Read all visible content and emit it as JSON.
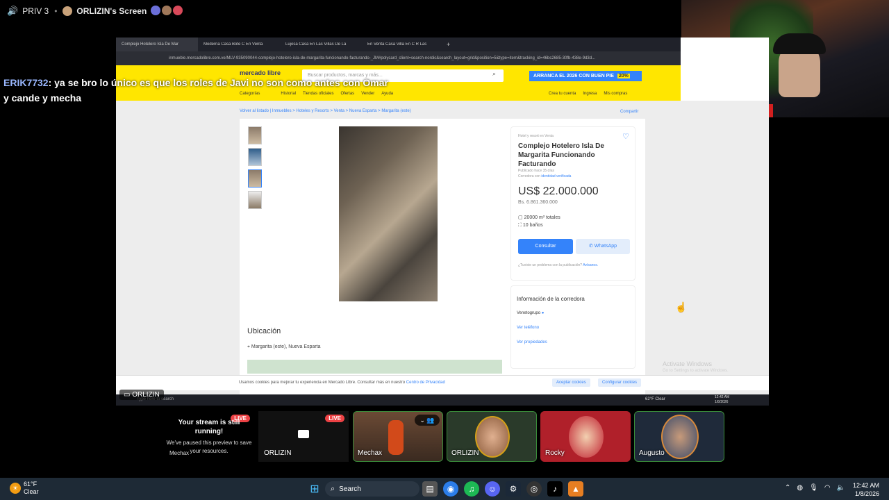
{
  "discord": {
    "channel": "PRIV 3",
    "screen_title": "ORLIZIN's Screen",
    "chat": {
      "user": "ERIK7732",
      "message": ": ya se bro lo único es que los roles de Javi no son como antes con Omar y cande y mecha"
    },
    "stream_label": "ORLIZIN",
    "paused_title": "Your stream is still running!",
    "paused_body": "We've paused this preview to save your resources.",
    "live": "LIVE",
    "participants": [
      {
        "name": "Mechax"
      },
      {
        "name": "ORLIZIN"
      },
      {
        "name": "Mechax"
      },
      {
        "name": "ORLIZIN"
      },
      {
        "name": "Rocky"
      },
      {
        "name": "Augusto"
      }
    ]
  },
  "browser": {
    "tabs": [
      "Complejo Hotelero Isla De Mar",
      "Moderna Casa Bote C En Venta",
      "Lujosa Casa En Las Villas De La",
      "En Venta Casa Villa En C R Las"
    ],
    "url": "inmueble.mercadolibre.com.ve/MLV-935090044-complejo-hotelero-isla-de-margarita-funcionando-facturando-_JM#polycard_client=search-nordic&search_layout=grid&position=5&type=item&tracking_id=46bc2685-30fb-438e-9d3d..."
  },
  "ml": {
    "logo": "mercado libre",
    "search_placeholder": "Buscar productos, marcas y más...",
    "promo": "ARRANCA EL 2026 CON BUEN PIE",
    "promo_badge": "20%",
    "nav": [
      "Categorías",
      "Historial",
      "Tiendas oficiales",
      "Ofertas",
      "Vender",
      "Ayuda"
    ],
    "nav_right": [
      "Crea tu cuenta",
      "Ingresa",
      "Mis compras"
    ],
    "breadcrumb": "Volver al listado  |  Inmuebles > Hoteles y Resorts > Venta > Nueva Esparta > Margarita (este)",
    "share": "Compartir",
    "category": "Hotel y resort en Venta",
    "title": "Complejo Hotelero Isla De Margarita Funcionando Facturando",
    "published": "Publicado hace 35 días",
    "broker_prefix": "Corredora con",
    "broker_verified": "identidad verificada",
    "price": "US$ 22.000.000",
    "price_local": "Bs. 6.861.360.000",
    "area": "20000 m² totales",
    "baths": "10 baños",
    "contact_btn": "Consultar",
    "whatsapp_btn": "WhatsApp",
    "problem": "¿Tuviste un problema con la publicación?",
    "problem_link": "Avísanos.",
    "seller_heading": "Información de la corredora",
    "seller_name": "Venetogrupo",
    "seller_phone": "Ver teléfono",
    "seller_props": "Ver propiedades",
    "location_heading": "Ubicación",
    "location": "Margarita (este), Nueva Esparta",
    "cookie_text": "Usamos cookies para mejorar tu experiencia en Mercado Libre. Consultar más en nuestro",
    "cookie_link": "Centro de Privacidad",
    "cookie_accept": "Aceptar cookies",
    "cookie_config": "Configurar cookies",
    "activate": "Activate Windows",
    "activate_sub": "Go to Settings to activate Windows."
  },
  "inner_taskbar": {
    "search": "Type here to search",
    "weather": "62°F  Clear",
    "time": "12:42 AM",
    "date": "1/8/2026"
  },
  "taskbar": {
    "temp": "61°F",
    "weather": "Clear",
    "search": "Search",
    "time": "12:42 AM",
    "date": "1/8/2026"
  }
}
